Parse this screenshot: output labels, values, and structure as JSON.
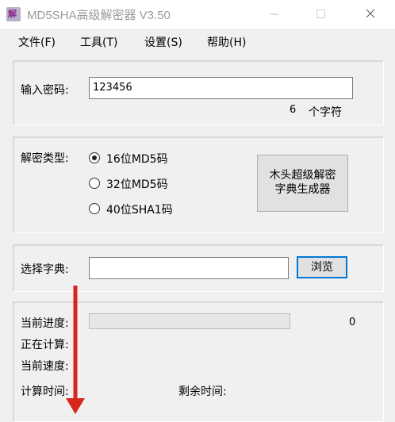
{
  "window": {
    "title": "MD5SHA高级解密器 V3.50",
    "icon_text": "解"
  },
  "menu": [
    {
      "label": "文件(F)"
    },
    {
      "label": "工具(T)"
    },
    {
      "label": "设置(S)"
    },
    {
      "label": "帮助(H)"
    }
  ],
  "password": {
    "label": "输入密码:",
    "value": "123456",
    "char_count": "6",
    "char_suffix": "个字符"
  },
  "decrypt_type": {
    "label": "解密类型:",
    "options": [
      {
        "label": "16位MD5码",
        "checked": true
      },
      {
        "label": "32位MD5码",
        "checked": false
      },
      {
        "label": "40位SHA1码",
        "checked": false
      }
    ],
    "generator_button_line1": "木头超级解密",
    "generator_button_line2": "字典生成器"
  },
  "dictionary": {
    "label": "选择字典:",
    "value": "",
    "browse_label": "浏览"
  },
  "status": {
    "progress_label": "当前进度:",
    "progress_fraction": 0,
    "progress_value": "0",
    "computing_label": "正在计算:",
    "speed_label": "当前速度:",
    "time_label": "计算时间:",
    "remaining_label": "剩余时间:"
  },
  "annotation": {
    "arrow_color": "#d9261c",
    "arrow_icon": "down-arrow-icon"
  }
}
